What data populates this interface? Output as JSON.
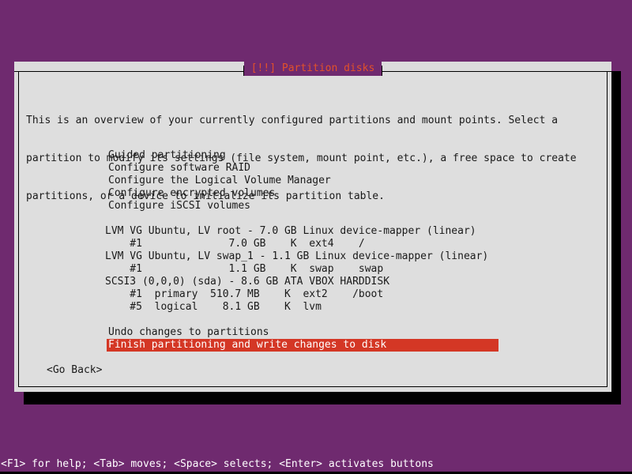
{
  "screen": {
    "background_color": "#6f2a6f",
    "dialog_bg": "#dedede",
    "frame_bg": "#dcdcdc",
    "highlight_color": "#d43725",
    "title_color": "#e2512a",
    "text_color": "#1a1a1a"
  },
  "dialog": {
    "title": "[!!] Partition disks",
    "description": [
      "This is an overview of your currently configured partitions and mount points. Select a",
      "partition to modify its settings (file system, mount point, etc.), a free space to create",
      "partitions, or a device to initialize its partition table."
    ],
    "menu_items": [
      {
        "label": "Guided partitioning"
      },
      {
        "label": "Configure software RAID"
      },
      {
        "label": "Configure the Logical Volume Manager"
      },
      {
        "label": "Configure encrypted volumes"
      },
      {
        "label": "Configure iSCSI volumes"
      }
    ],
    "partition_lines": [
      {
        "text": "LVM VG Ubuntu, LV root - 7.0 GB Linux device-mapper (linear)",
        "kind": "device"
      },
      {
        "text": "    #1              7.0 GB    K  ext4    /",
        "kind": "partition"
      },
      {
        "text": "LVM VG Ubuntu, LV swap_1 - 1.1 GB Linux device-mapper (linear)",
        "kind": "device"
      },
      {
        "text": "    #1              1.1 GB    K  swap    swap",
        "kind": "partition"
      },
      {
        "text": "SCSI3 (0,0,0) (sda) - 8.6 GB ATA VBOX HARDDISK",
        "kind": "device"
      },
      {
        "text": "    #1  primary  510.7 MB    K  ext2    /boot",
        "kind": "partition"
      },
      {
        "text": "    #5  logical    8.1 GB    K  lvm",
        "kind": "partition"
      }
    ],
    "actions": {
      "undo_label": "Undo changes to partitions",
      "finish_label": "Finish partitioning and write changes to disk",
      "finish_selected": true
    },
    "buttons": {
      "go_back": "<Go Back>"
    }
  },
  "statusbar": {
    "text": "<F1> for help; <Tab> moves; <Space> selects; <Enter> activates buttons"
  }
}
